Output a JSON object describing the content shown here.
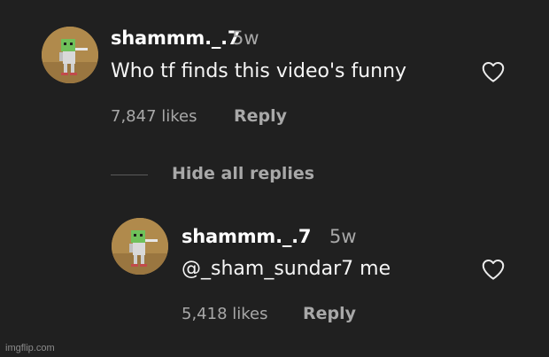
{
  "comments": [
    {
      "username": "shammm._.7",
      "age": "5w",
      "text": "Who tf finds this video's funny",
      "likes": "7,847 likes",
      "reply_label": "Reply"
    }
  ],
  "hide_replies_label": "Hide all replies",
  "replies": [
    {
      "username": "shammm._.7",
      "age": "5w",
      "text": "@_sham_sundar7 me",
      "likes": "5,418 likes",
      "reply_label": "Reply"
    }
  ],
  "watermark": "imgflip.com",
  "colors": {
    "background": "#202020",
    "primary_text": "#ffffff",
    "secondary_text": "#a8a8a8",
    "avatar_bg": "#b08a4c"
  },
  "icons": {
    "like": "heart-outline-icon",
    "avatar": "green-character-avatar"
  }
}
